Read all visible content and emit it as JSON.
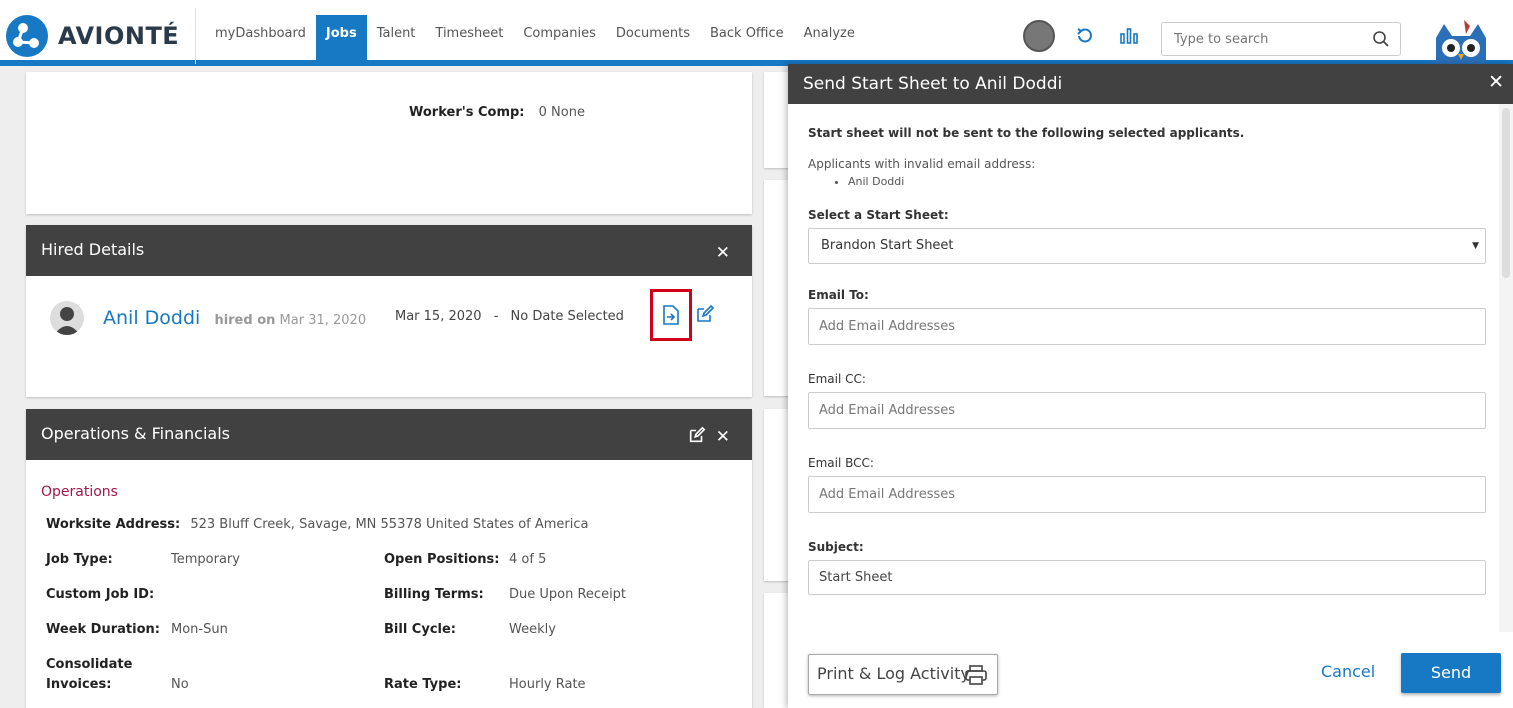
{
  "brand": {
    "name": "AVIONTÉ"
  },
  "nav": {
    "items": [
      {
        "label": "myDashboard",
        "active": false
      },
      {
        "label": "Jobs",
        "active": true
      },
      {
        "label": "Talent",
        "active": false
      },
      {
        "label": "Timesheet",
        "active": false
      },
      {
        "label": "Companies",
        "active": false
      },
      {
        "label": "Documents",
        "active": false
      },
      {
        "label": "Back Office",
        "active": false
      },
      {
        "label": "Analyze",
        "active": false
      }
    ],
    "search_placeholder": "Type to search"
  },
  "top_card": {
    "workers_comp_label": "Worker's Comp:",
    "workers_comp_value": "0 None"
  },
  "hired": {
    "title": "Hired Details",
    "name": "Anil Doddi",
    "hired_on_label": "hired on",
    "hired_on_date": "Mar 31, 2020",
    "start_date": "Mar 15, 2020",
    "separator": "-",
    "end_date": "No Date Selected"
  },
  "ops": {
    "title": "Operations & Financials",
    "section": "Operations",
    "worksite_label": "Worksite Address:",
    "worksite_value": "523 Bluff Creek, Savage, MN 55378 United States of America",
    "rows": [
      {
        "l1": "Job Type:",
        "v1": "Temporary",
        "l2": "Open Positions:",
        "v2": "4 of 5"
      },
      {
        "l1": "Custom Job ID:",
        "v1": "",
        "l2": "Billing Terms:",
        "v2": "Due Upon Receipt"
      },
      {
        "l1": "Week Duration:",
        "v1": "Mon-Sun",
        "l2": "Bill Cycle:",
        "v2": "Weekly"
      }
    ],
    "consolidate_label_1": "Consolidate",
    "consolidate_label_2": "Invoices:",
    "consolidate_value": "No",
    "rate_type_label": "Rate Type:",
    "rate_type_value": "Hourly Rate"
  },
  "modal": {
    "title": "Send Start Sheet to Anil Doddi",
    "warning": "Start sheet will not be sent to the following selected applicants.",
    "invalid_label": "Applicants with invalid email address:",
    "invalid_list": [
      "Anil Doddi"
    ],
    "select_label": "Select a Start Sheet:",
    "select_value": "Brandon Start Sheet",
    "email_to_label": "Email To:",
    "email_cc_label": "Email CC:",
    "email_bcc_label": "Email BCC:",
    "email_placeholder": "Add Email Addresses",
    "subject_label": "Subject:",
    "subject_value": "Start Sheet",
    "print_label": "Print & Log Activity",
    "cancel_label": "Cancel",
    "send_label": "Send"
  }
}
